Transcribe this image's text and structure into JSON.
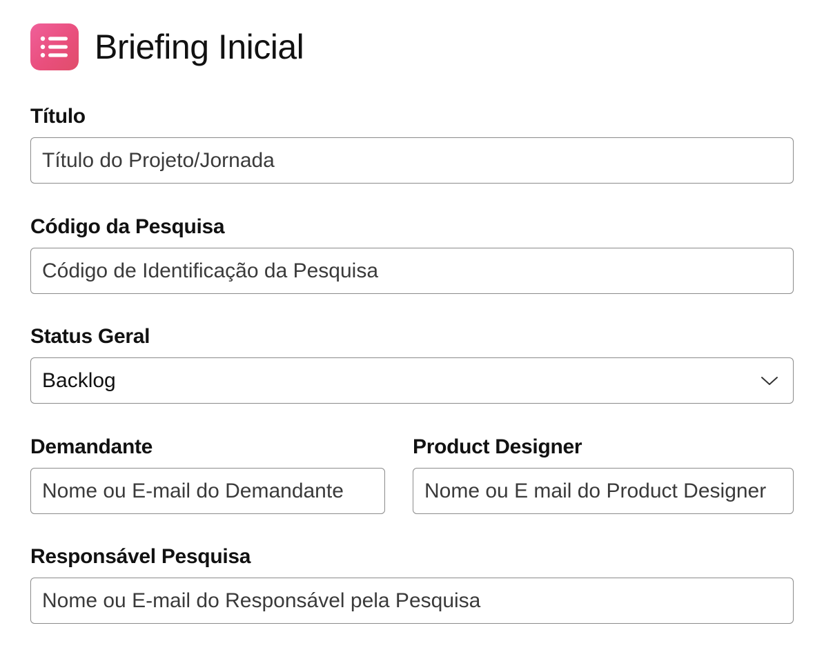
{
  "header": {
    "title": "Briefing Inicial",
    "icon": "list-icon",
    "icon_color": "#e94f7d"
  },
  "fields": {
    "titulo": {
      "label": "Título",
      "placeholder": "Título do Projeto/Jornada",
      "value": ""
    },
    "codigo": {
      "label": "Código da Pesquisa",
      "placeholder": "Código de Identificação da Pesquisa",
      "value": ""
    },
    "status": {
      "label": "Status Geral",
      "selected": "Backlog",
      "icon": "chevron-down-icon"
    },
    "demandante": {
      "label": "Demandante",
      "placeholder": "Nome ou E-mail do Demandante",
      "value": ""
    },
    "product_designer": {
      "label": "Product Designer",
      "placeholder": "Nome ou E mail do Product Designer",
      "value": ""
    },
    "responsavel": {
      "label": "Responsável Pesquisa",
      "placeholder": "Nome ou E-mail do Responsável pela Pesquisa",
      "value": ""
    }
  }
}
